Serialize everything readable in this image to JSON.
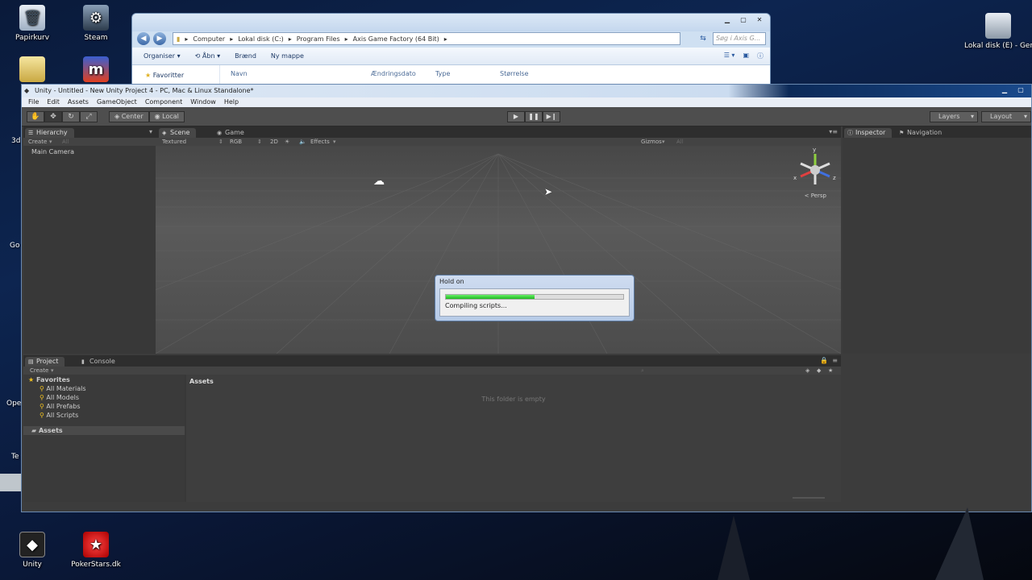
{
  "desktop": {
    "icons": [
      {
        "label": "Papirkurv",
        "icon": "recycle-bin-icon"
      },
      {
        "label": "Steam",
        "icon": "steam-icon"
      },
      {
        "label": "Lokal disk (E) - Genvej",
        "icon": "drive-shortcut-icon"
      },
      {
        "label": "Unity",
        "icon": "unity-icon"
      },
      {
        "label": "PokerStars.dk",
        "icon": "pokerstars-icon"
      }
    ],
    "partial_labels": [
      "3d",
      "Go",
      "Ope",
      "Te"
    ]
  },
  "explorer": {
    "breadcrumb": [
      "Computer",
      "Lokal disk (C:)",
      "Program Files",
      "Axis Game Factory (64 Bit)"
    ],
    "search_placeholder": "Søg i Axis G...",
    "toolbar": {
      "organize": "Organiser",
      "open": "Åbn",
      "burn": "Brænd",
      "new_folder": "Ny mappe"
    },
    "favorites": "Favoritter",
    "columns": [
      "Navn",
      "Ændringsdato",
      "Type",
      "Størrelse"
    ]
  },
  "unity": {
    "title": "Unity - Untitled - New Unity Project 4 - PC, Mac & Linux Standalone*",
    "menu": [
      "File",
      "Edit",
      "Assets",
      "GameObject",
      "Component",
      "Window",
      "Help"
    ],
    "pivot": {
      "center": "Center",
      "local": "Local"
    },
    "layers": "Layers",
    "layout": "Layout",
    "hierarchy": {
      "tab": "Hierarchy",
      "create": "Create",
      "search": "All",
      "items": [
        "Main Camera"
      ]
    },
    "scene": {
      "tabs": [
        "Scene",
        "Game"
      ],
      "shading": "Textured",
      "render": "RGB",
      "mode2d": "2D",
      "effects": "Effects",
      "gizmos": "Gizmos",
      "gizmo_search": "All",
      "persp": "Persp",
      "axes": {
        "x": "x",
        "y": "y",
        "z": "z"
      }
    },
    "inspector": {
      "tabs": [
        "Inspector",
        "Navigation"
      ]
    },
    "project": {
      "tabs": [
        "Project",
        "Console"
      ],
      "create": "Create",
      "favorites": "Favorites",
      "favorite_items": [
        "All Materials",
        "All Models",
        "All Prefabs",
        "All Scripts"
      ],
      "assets": "Assets",
      "assets_header": "Assets",
      "empty_message": "This folder is empty"
    }
  },
  "dialog": {
    "title": "Hold on",
    "message": "Compiling scripts...",
    "progress": 0.5
  }
}
